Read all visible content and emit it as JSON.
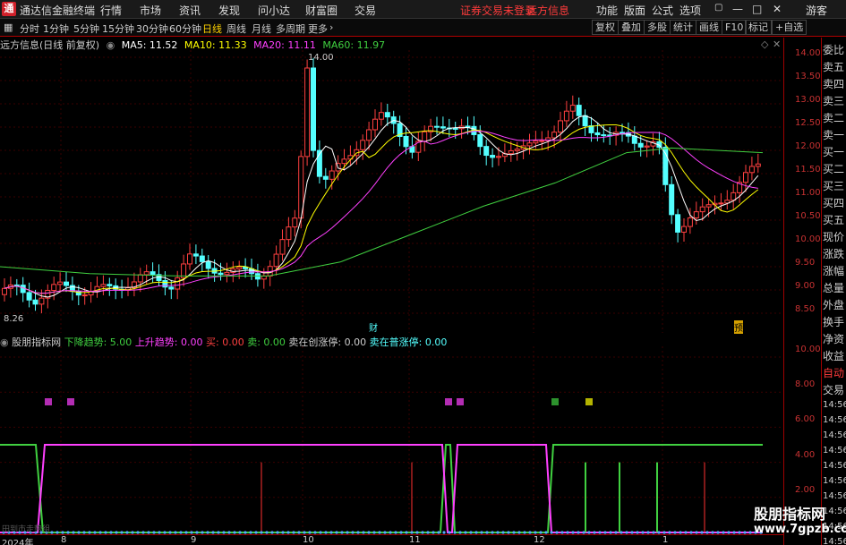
{
  "titlebar": {
    "app_name": "通达信金融终端",
    "menus": [
      "行情",
      "市场",
      "资讯",
      "发现",
      "问小达",
      "财富圈",
      "交易"
    ],
    "login_status": "证券交易未登录",
    "stock_name": "远方信息",
    "right_menus": [
      "功能",
      "版面",
      "公式",
      "选项"
    ],
    "guest": "游客"
  },
  "toolbar": {
    "periods": [
      "分时",
      "1分钟",
      "5分钟",
      "15分钟",
      "30分钟",
      "60分钟",
      "日线",
      "周线",
      "月线",
      "多周期",
      "更多"
    ],
    "selected_period": "日线",
    "right_buttons": [
      "复权",
      "叠加",
      "多股",
      "统计",
      "画线",
      "F10",
      "标记",
      "+自选"
    ]
  },
  "main": {
    "title": "远方信息(日线 前复权)",
    "ma5": "MA5: 11.52",
    "ma10": "MA10: 11.33",
    "ma20": "MA20: 11.11",
    "ma60": "MA60: 11.97",
    "high_label": "14.00",
    "low_label": "8.26",
    "marker_cai": "财",
    "marker_yu": "预"
  },
  "y_axis_main": [
    "14.00",
    "13.50",
    "13.00",
    "12.50",
    "12.00",
    "11.50",
    "11.00",
    "10.50",
    "10.00",
    "9.50",
    "9.00",
    "8.50"
  ],
  "y_axis_ind": [
    "10.00",
    "8.00",
    "6.00",
    "4.00",
    "2.00"
  ],
  "indicator": {
    "name": "股朋指标网",
    "down": "下降趋势: 5.00",
    "up": "上升趋势: 0.00",
    "buy": "买: 0.00",
    "sell": "卖: 0.00",
    "sell_new": "卖在创涨停: 0.00",
    "sell_limit": "卖在普涨停: 0.00"
  },
  "sidebar": [
    "委比",
    "卖五",
    "卖四",
    "卖三",
    "卖二",
    "卖一",
    "买一",
    "买二",
    "买三",
    "买四",
    "买五",
    "现价",
    "涨跌",
    "涨幅",
    "总量",
    "外盘",
    "换手",
    "净资",
    "收益",
    "自动",
    "交易"
  ],
  "sidebar_times": [
    "14:56",
    "14:56",
    "14:56",
    "14:56",
    "14:56",
    "14:56",
    "14:56",
    "14:56",
    "14:56",
    "14:56"
  ],
  "x_axis": [
    "2024年",
    "8",
    "9",
    "10",
    "11",
    "12",
    "1"
  ],
  "bottom_hint": "田到市走势组",
  "watermark": {
    "name": "股朋指标网",
    "url": "www.7gpzb.com"
  },
  "colors": {
    "up": "#ff4040",
    "down": "#54ffff",
    "ma5": "#ffffff",
    "ma10": "#ffff00",
    "ma20": "#ff40ff",
    "ma60": "#40d040",
    "accent_red": "#c80000"
  }
}
